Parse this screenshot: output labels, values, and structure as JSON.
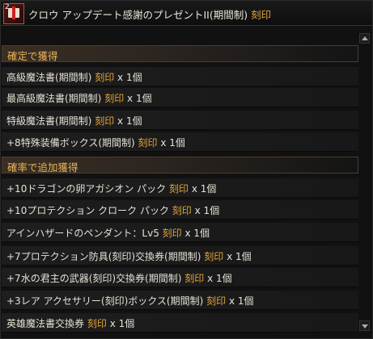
{
  "title": {
    "item_count": "2",
    "text": "クロウ アップデート感謝のプレゼントII(期間制)",
    "tag": "刻印"
  },
  "sections": [
    {
      "header": "確定で獲得",
      "items": [
        {
          "name": "高級魔法書(期間制)",
          "tag": "刻印",
          "qty": "x 1個"
        },
        {
          "name": "最高級魔法書(期間制)",
          "tag": "刻印",
          "qty": "x 1個"
        },
        {
          "name": "特級魔法書(期間制)",
          "tag": "刻印",
          "qty": "x 1個"
        },
        {
          "name": "+8特殊装備ボックス(期間制)",
          "tag": "刻印",
          "qty": "x 1個"
        }
      ]
    },
    {
      "header": "確率で追加獲得",
      "items": [
        {
          "name": "+10ドラゴンの卵アガシオン パック",
          "tag": "刻印",
          "qty": "x 1個"
        },
        {
          "name": "+10プロテクション クローク パック",
          "tag": "刻印",
          "qty": "x 1個"
        },
        {
          "name": "アインハザードのペンダント：Lv5",
          "tag": "刻印",
          "qty": "x 1個"
        },
        {
          "name": "+7プロテクション防具(刻印)交換券(期間制)",
          "tag": "刻印",
          "qty": "x 1個"
        },
        {
          "name": "+7水の君主の武器(刻印)交換券(期間制)",
          "tag": "刻印",
          "qty": "x 1個"
        },
        {
          "name": "+3レア アクセサリー(刻印)ボックス(期間制)",
          "tag": "刻印",
          "qty": "x 1個"
        },
        {
          "name": "英雄魔法書交換券",
          "tag": "刻印",
          "qty": "x 1個"
        }
      ]
    }
  ],
  "icons": {
    "item": "gift-box-icon",
    "scroll_up": "arrow-up-icon",
    "scroll_down": "arrow-down-icon"
  },
  "colors": {
    "accent": "#e0a43a",
    "header_text": "#eab45a",
    "body_text": "#e6e1d6",
    "background": "#111111"
  }
}
